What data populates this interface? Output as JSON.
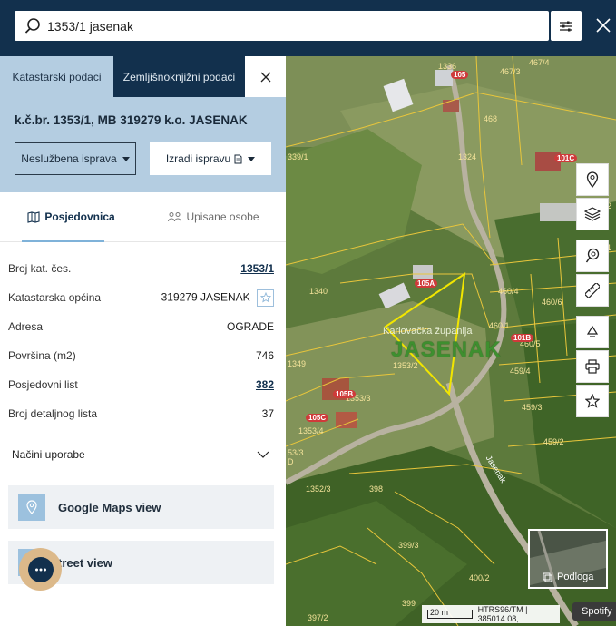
{
  "search": {
    "value": "1353/1 jasenak",
    "icons": [
      "search-icon",
      "filter-sliders-icon",
      "close-icon"
    ]
  },
  "panel": {
    "tabs": [
      {
        "label": "Katastarski podaci",
        "active": true
      },
      {
        "label": "Zemljišnoknjižni podaci",
        "active": false
      }
    ],
    "title": "k.č.br. 1353/1, MB 319279 k.o. JASENAK",
    "buttons": {
      "informal_doc": "Neslužbena isprava",
      "create_doc": "Izradi ispravu"
    },
    "subtabs": {
      "possession": "Posjedovnica",
      "owners": "Upisane osobe"
    },
    "rows": [
      {
        "label": "Broj kat. čes.",
        "value": "1353/1",
        "link": true
      },
      {
        "label": "Katastarska općina",
        "value": "319279 JASENAK",
        "link": false
      },
      {
        "label": "Adresa",
        "value": "OGRADE",
        "link": false
      },
      {
        "label": "Površina (m2)",
        "value": "746",
        "link": false
      },
      {
        "label": "Posjedovni list",
        "value": "382",
        "link": true
      },
      {
        "label": "Broj detaljnog lista",
        "value": "37",
        "link": false
      }
    ],
    "accordion_label": "Načini uporabe",
    "cards": {
      "google_maps": "Google Maps view",
      "street_view": "treet view"
    }
  },
  "map": {
    "parcel_labels": [
      "1336",
      "467/3",
      "467/4",
      "468",
      "339/1",
      "1324",
      "460/4",
      "460/5",
      "460/6",
      "460/1",
      "459/4",
      "459/3",
      "459/2",
      "1349",
      "1353/2",
      "1353/3",
      "1353/4",
      "1352/3",
      "398",
      "399/3",
      "400/2",
      "397/2",
      "399",
      "462",
      "461",
      "1340",
      "53/3",
      "D"
    ],
    "building_tags": [
      "105",
      "101C",
      "105A",
      "101B",
      "105B",
      "105C"
    ],
    "county": "Karlovačka županija",
    "municipality": "JASENAK",
    "street": "Jasenak",
    "basemap_label": "Podloga",
    "scale_label": "20 m",
    "coords": "HTRS96/TM | 385014.08,",
    "spotify": "Spotify",
    "colors": {
      "parcel_line": "#e9c63b",
      "selected_parcel": "#f2e600",
      "tag": "#cf3a3a"
    }
  }
}
